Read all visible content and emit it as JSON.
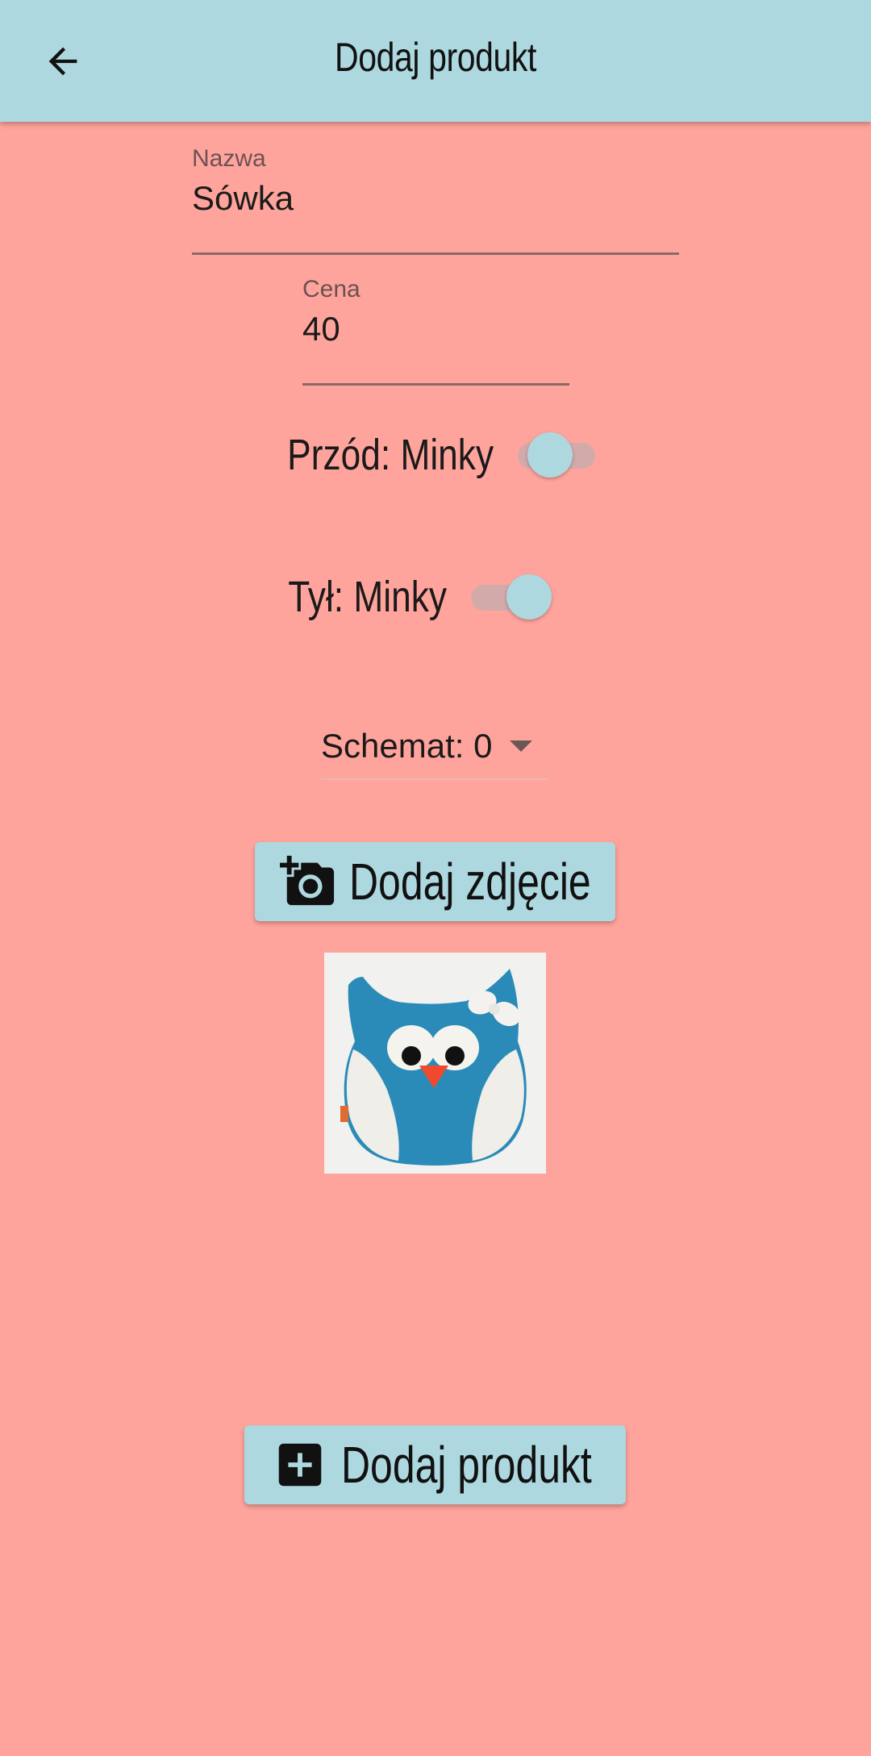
{
  "appbar": {
    "title": "Dodaj produkt"
  },
  "form": {
    "name": {
      "label": "Nazwa",
      "value": "Sówka"
    },
    "price": {
      "label": "Cena",
      "value": "40"
    },
    "front_switch": {
      "label": "Przód: Minky",
      "on": true
    },
    "back_switch": {
      "label": "Tył: Minky",
      "on": true
    },
    "schema": {
      "value": "Schemat: 0"
    },
    "add_photo_label": "Dodaj zdjęcie",
    "submit_label": "Dodaj produkt"
  },
  "colors": {
    "background": "#FFA49C",
    "appbar": "#AED8DF",
    "accent": "#AED8DF"
  },
  "icons": {
    "back": "arrow-back-icon",
    "camera": "add-a-photo-icon",
    "add": "add-box-icon"
  }
}
